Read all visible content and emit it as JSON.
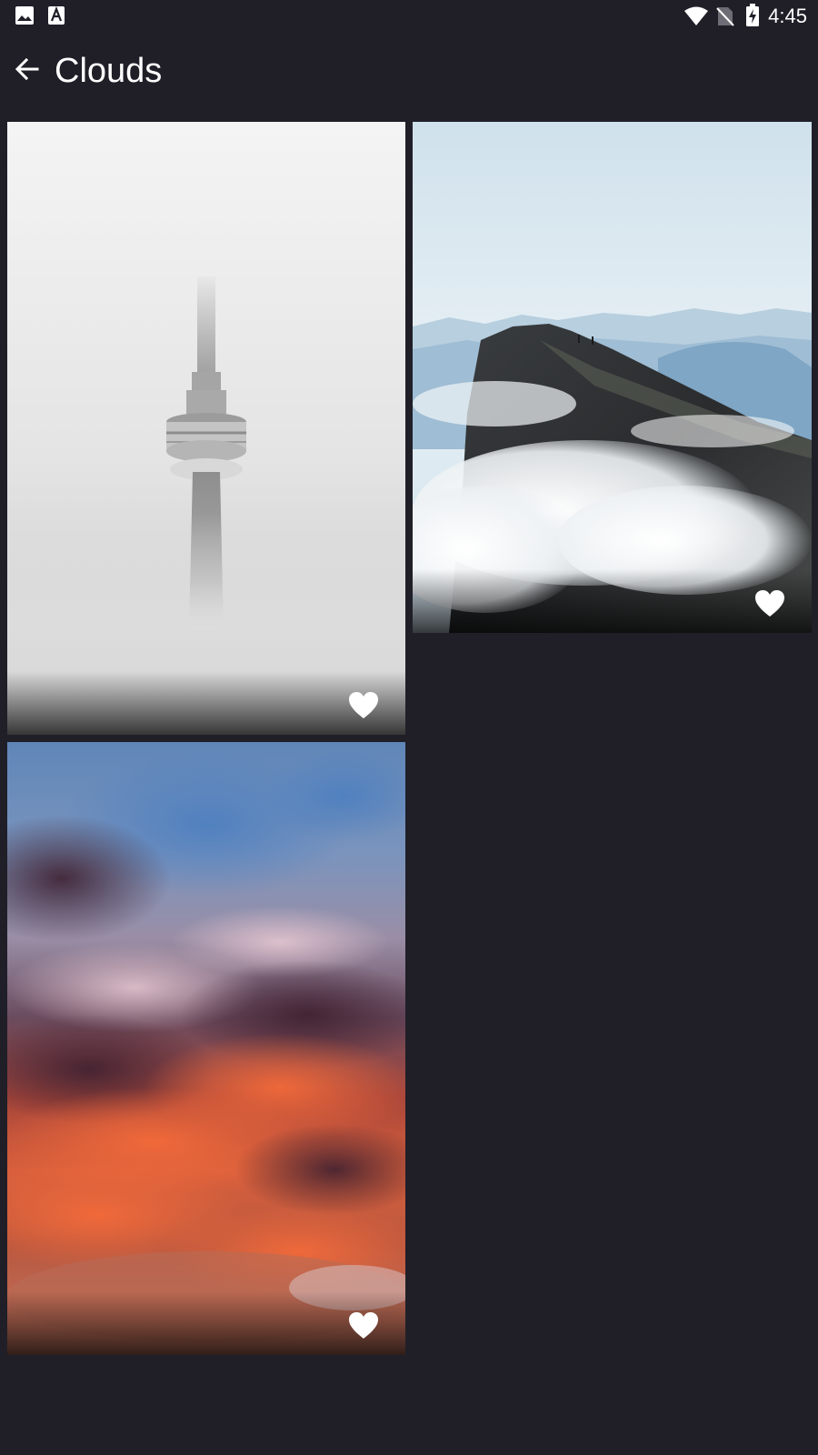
{
  "status_bar": {
    "time": "4:45",
    "icons": [
      "gallery-notification-icon",
      "font-notification-icon",
      "wifi-icon",
      "no-sim-icon",
      "battery-charging-icon"
    ]
  },
  "app_bar": {
    "title": "Clouds",
    "back_icon": "arrow-back-icon"
  },
  "photos": [
    {
      "subject": "tower-in-fog",
      "favorite_icon": "heart-icon"
    },
    {
      "subject": "mountain-peak-above-clouds",
      "favorite_icon": "heart-icon"
    },
    {
      "subject": "sunset-clouds",
      "favorite_icon": "heart-icon"
    }
  ],
  "colors": {
    "background": "#201f28",
    "foreground": "#ffffff"
  }
}
